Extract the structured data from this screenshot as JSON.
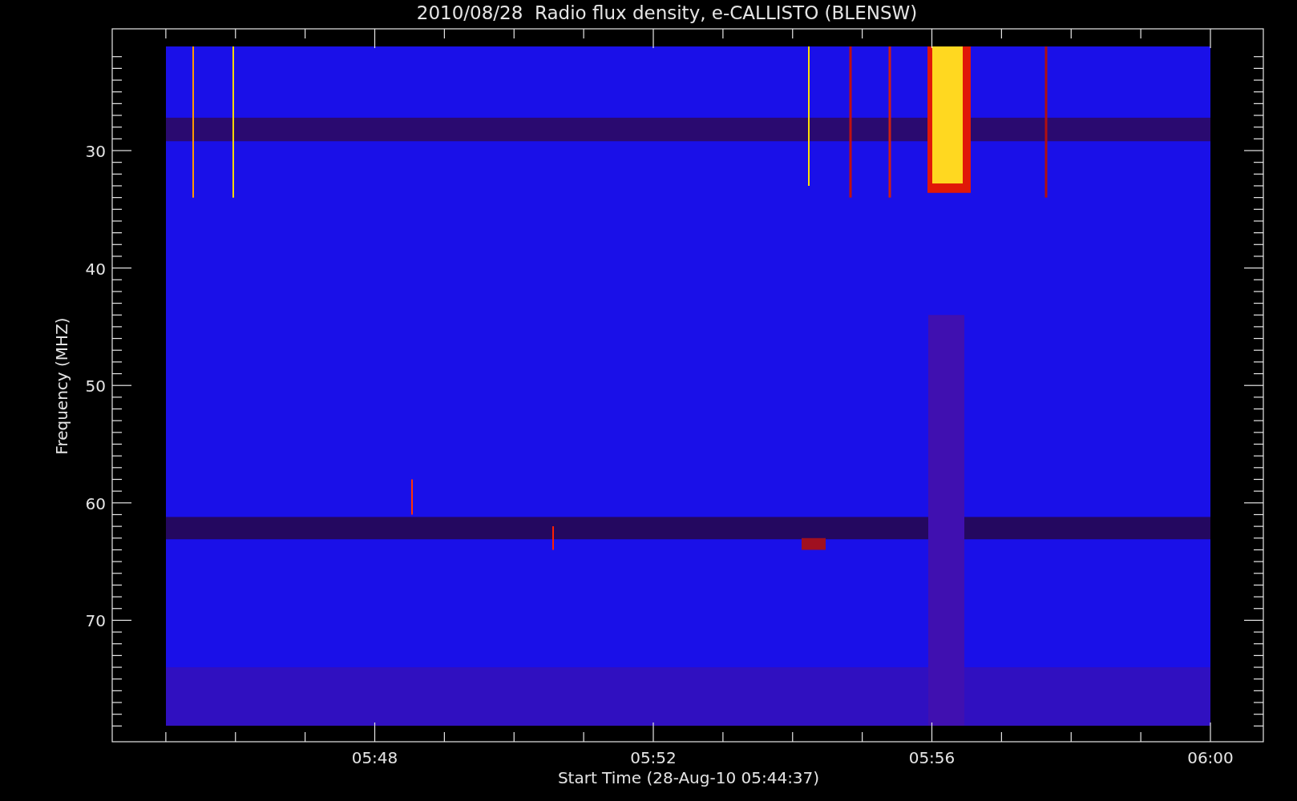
{
  "title": "2010/08/28  Radio flux density, e-CALLISTO (BLENSW)",
  "y_axis": {
    "label": "Frequency (MHZ)",
    "ticks": [
      "30",
      "40",
      "50",
      "60",
      "70"
    ]
  },
  "x_axis": {
    "label": "Start Time (28-Aug-10 05:44:37)",
    "ticks": [
      "05:48",
      "05:52",
      "05:56",
      "06:00"
    ]
  }
}
